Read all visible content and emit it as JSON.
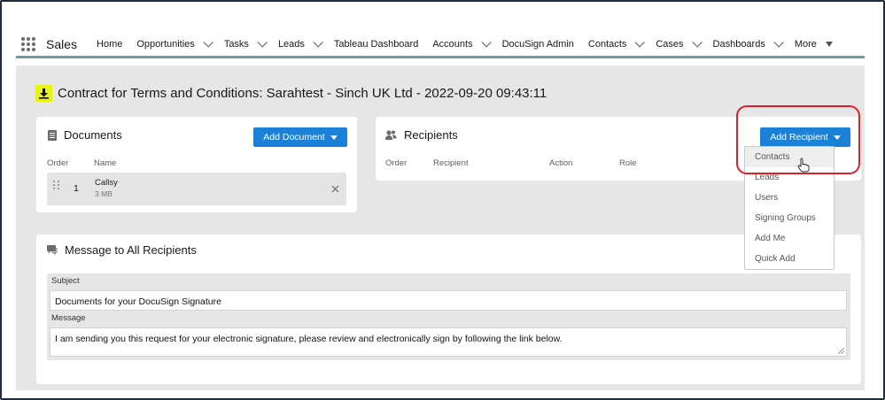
{
  "nav": {
    "app_name": "Sales",
    "items": [
      {
        "label": "Home",
        "chevron": false
      },
      {
        "label": "Opportunities",
        "chevron": true
      },
      {
        "label": "Tasks",
        "chevron": true
      },
      {
        "label": "Leads",
        "chevron": true
      },
      {
        "label": "Tableau Dashboard",
        "chevron": false
      },
      {
        "label": "Accounts",
        "chevron": true
      },
      {
        "label": "DocuSign Admin",
        "chevron": false
      },
      {
        "label": "Contacts",
        "chevron": true
      },
      {
        "label": "Cases",
        "chevron": true
      },
      {
        "label": "Dashboards",
        "chevron": true
      },
      {
        "label": "More",
        "chevron": false,
        "triangle": true
      }
    ]
  },
  "page": {
    "title": "Contract for Terms and Conditions: Sarahtest - Sinch UK Ltd - 2022-09-20 09:43:11",
    "title_icon": "download-icon"
  },
  "documents": {
    "title": "Documents",
    "add_button": "Add Document",
    "col_order": "Order",
    "col_name": "Name",
    "rows": [
      {
        "order": "1",
        "name": "Callsy",
        "size": "3 MB"
      }
    ]
  },
  "recipients": {
    "title": "Recipients",
    "add_button": "Add Recipient",
    "col_order": "Order",
    "col_recipient": "Recipient",
    "col_action": "Action",
    "col_role": "Role",
    "menu": [
      "Contacts",
      "Leads",
      "Users",
      "Signing Groups",
      "Add Me",
      "Quick Add"
    ]
  },
  "message": {
    "title": "Message to All Recipients",
    "subject_label": "Subject",
    "subject_value": "Documents for your DocuSign Signature",
    "message_label": "Message",
    "message_value": "I am sending you this request for your electronic signature, please review and electronically sign by following the link below."
  },
  "colors": {
    "accent": "#1b80d8",
    "highlight_ring": "#e01f26",
    "nav_underline": "#6a9d9d",
    "icon_yellow": "#e8f514"
  }
}
